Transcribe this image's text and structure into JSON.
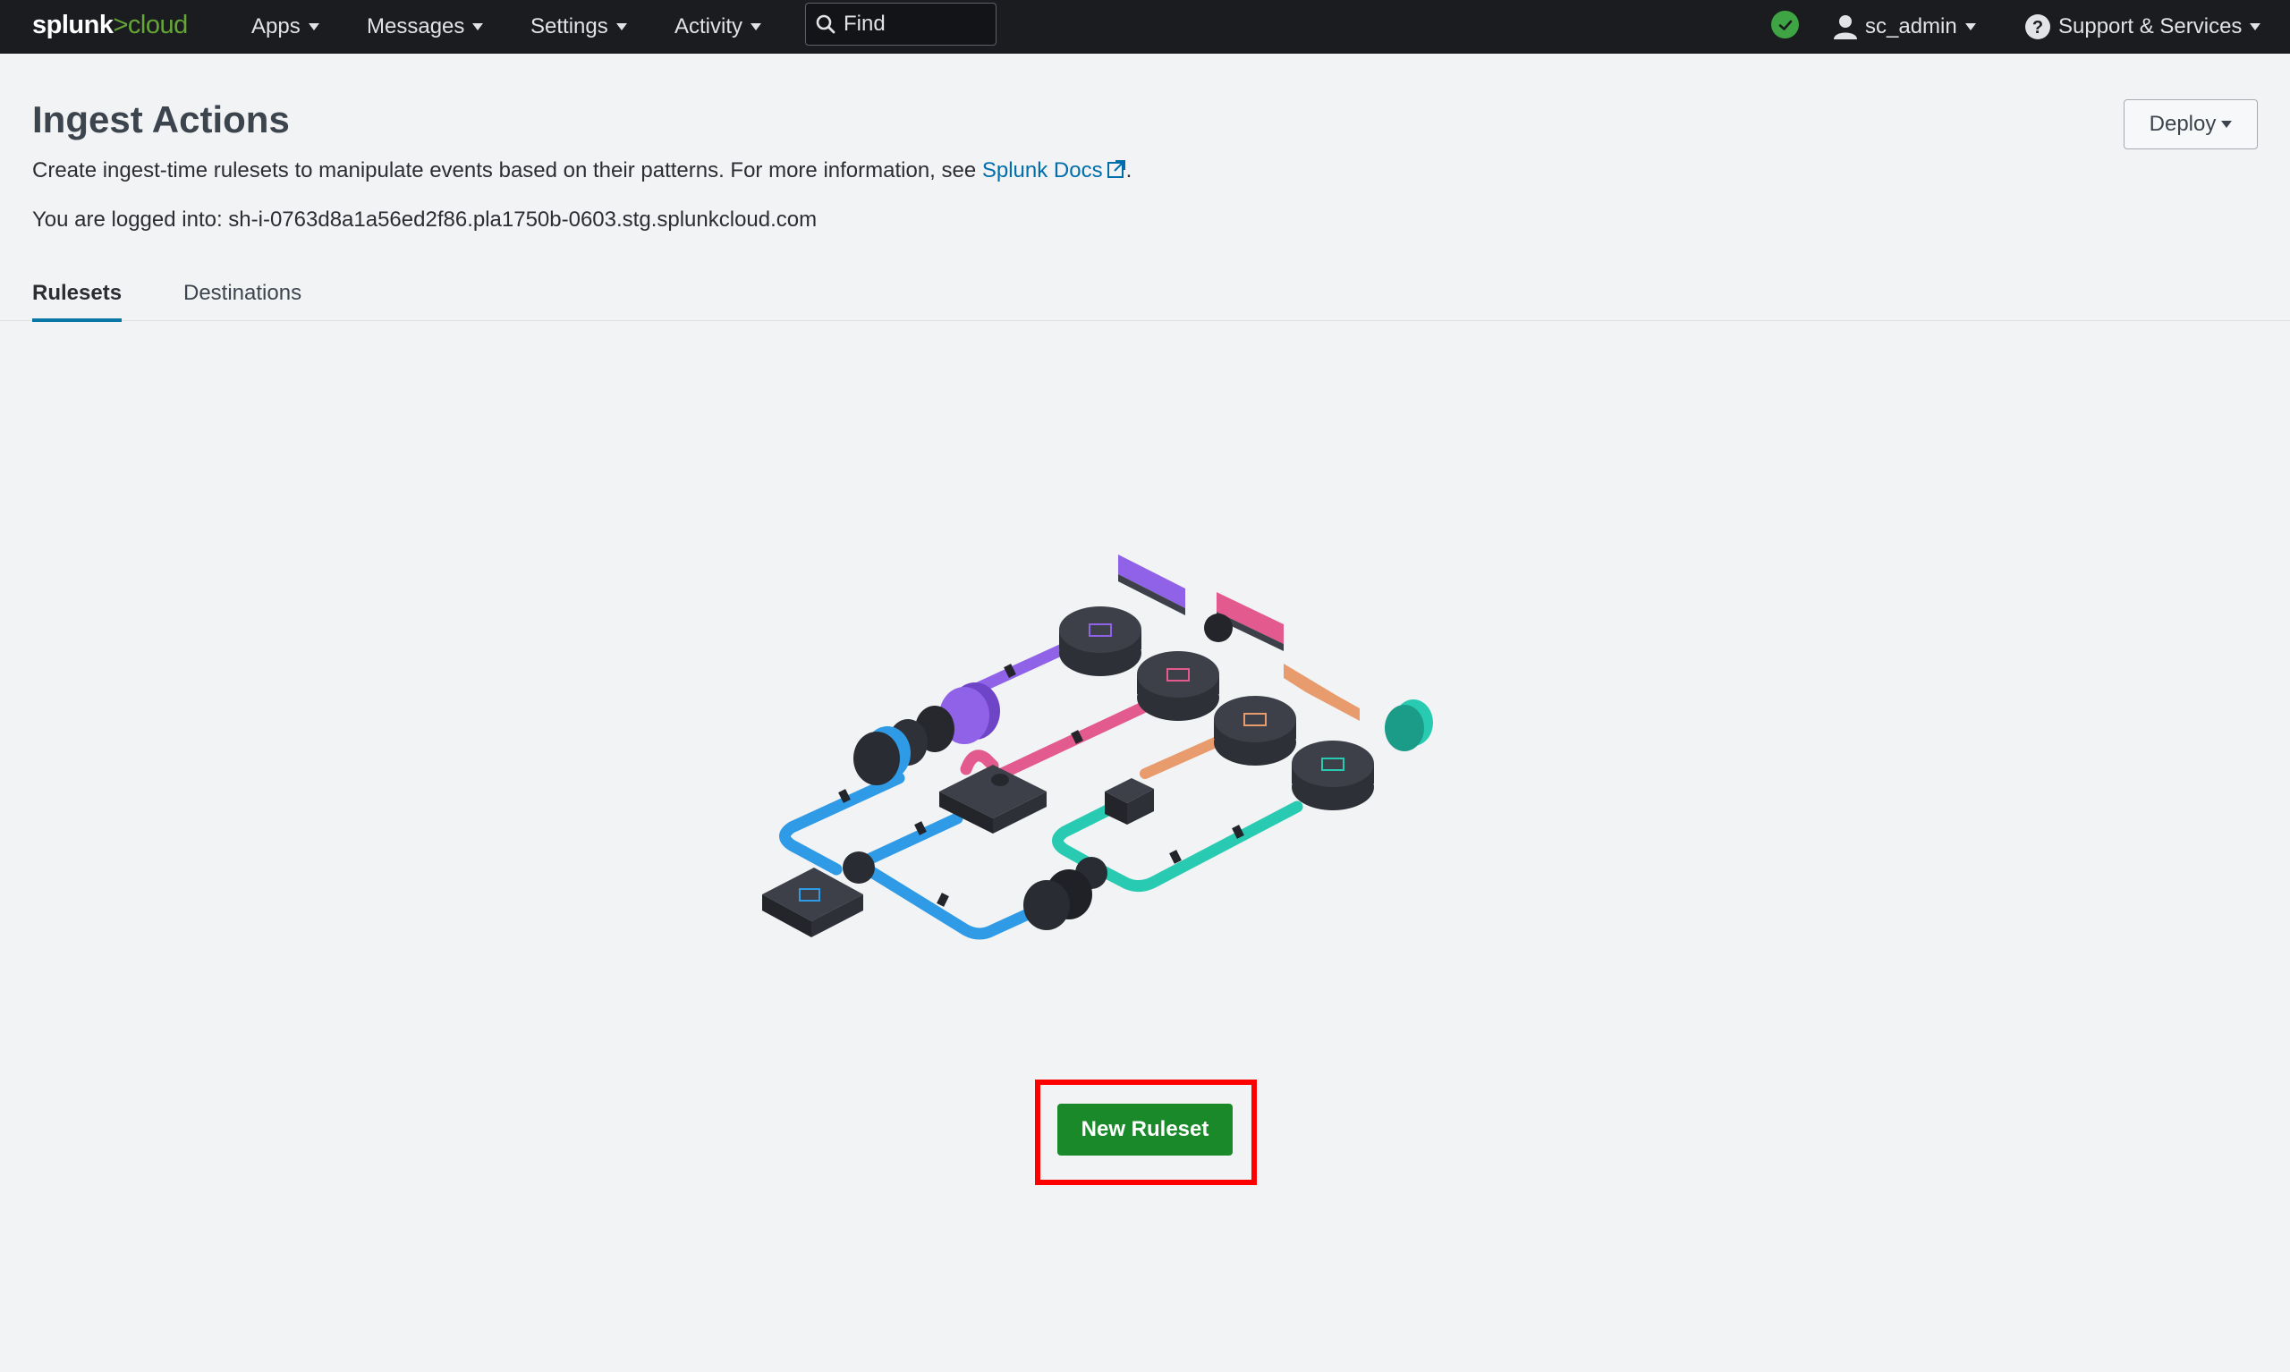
{
  "brand": {
    "logo_splunk": "splunk",
    "logo_gt": ">",
    "logo_cloud": "cloud",
    "accent": "#65a637"
  },
  "topbar": {
    "menus": [
      "Apps",
      "Messages",
      "Settings",
      "Activity"
    ],
    "find_placeholder": "Find",
    "status_color": "#3fa443",
    "user": "sc_admin",
    "support": "Support & Services"
  },
  "page": {
    "title": "Ingest Actions",
    "description": "Create ingest-time rulesets to manipulate events based on their patterns. For more information, see ",
    "docs_link": "Splunk Docs",
    "description_end": ".",
    "login_text": "You are logged into: sh-i-0763d8a1a56ed2f86.pla1750b-0603.stg.splunkcloud.com",
    "deploy_label": "Deploy"
  },
  "tabs": [
    "Rulesets",
    "Destinations"
  ],
  "empty_state": {
    "illustration": "pipeline-illustration",
    "button_label": "New Ruleset",
    "button_color": "#1a8929",
    "highlight_color": "#ff0000"
  }
}
